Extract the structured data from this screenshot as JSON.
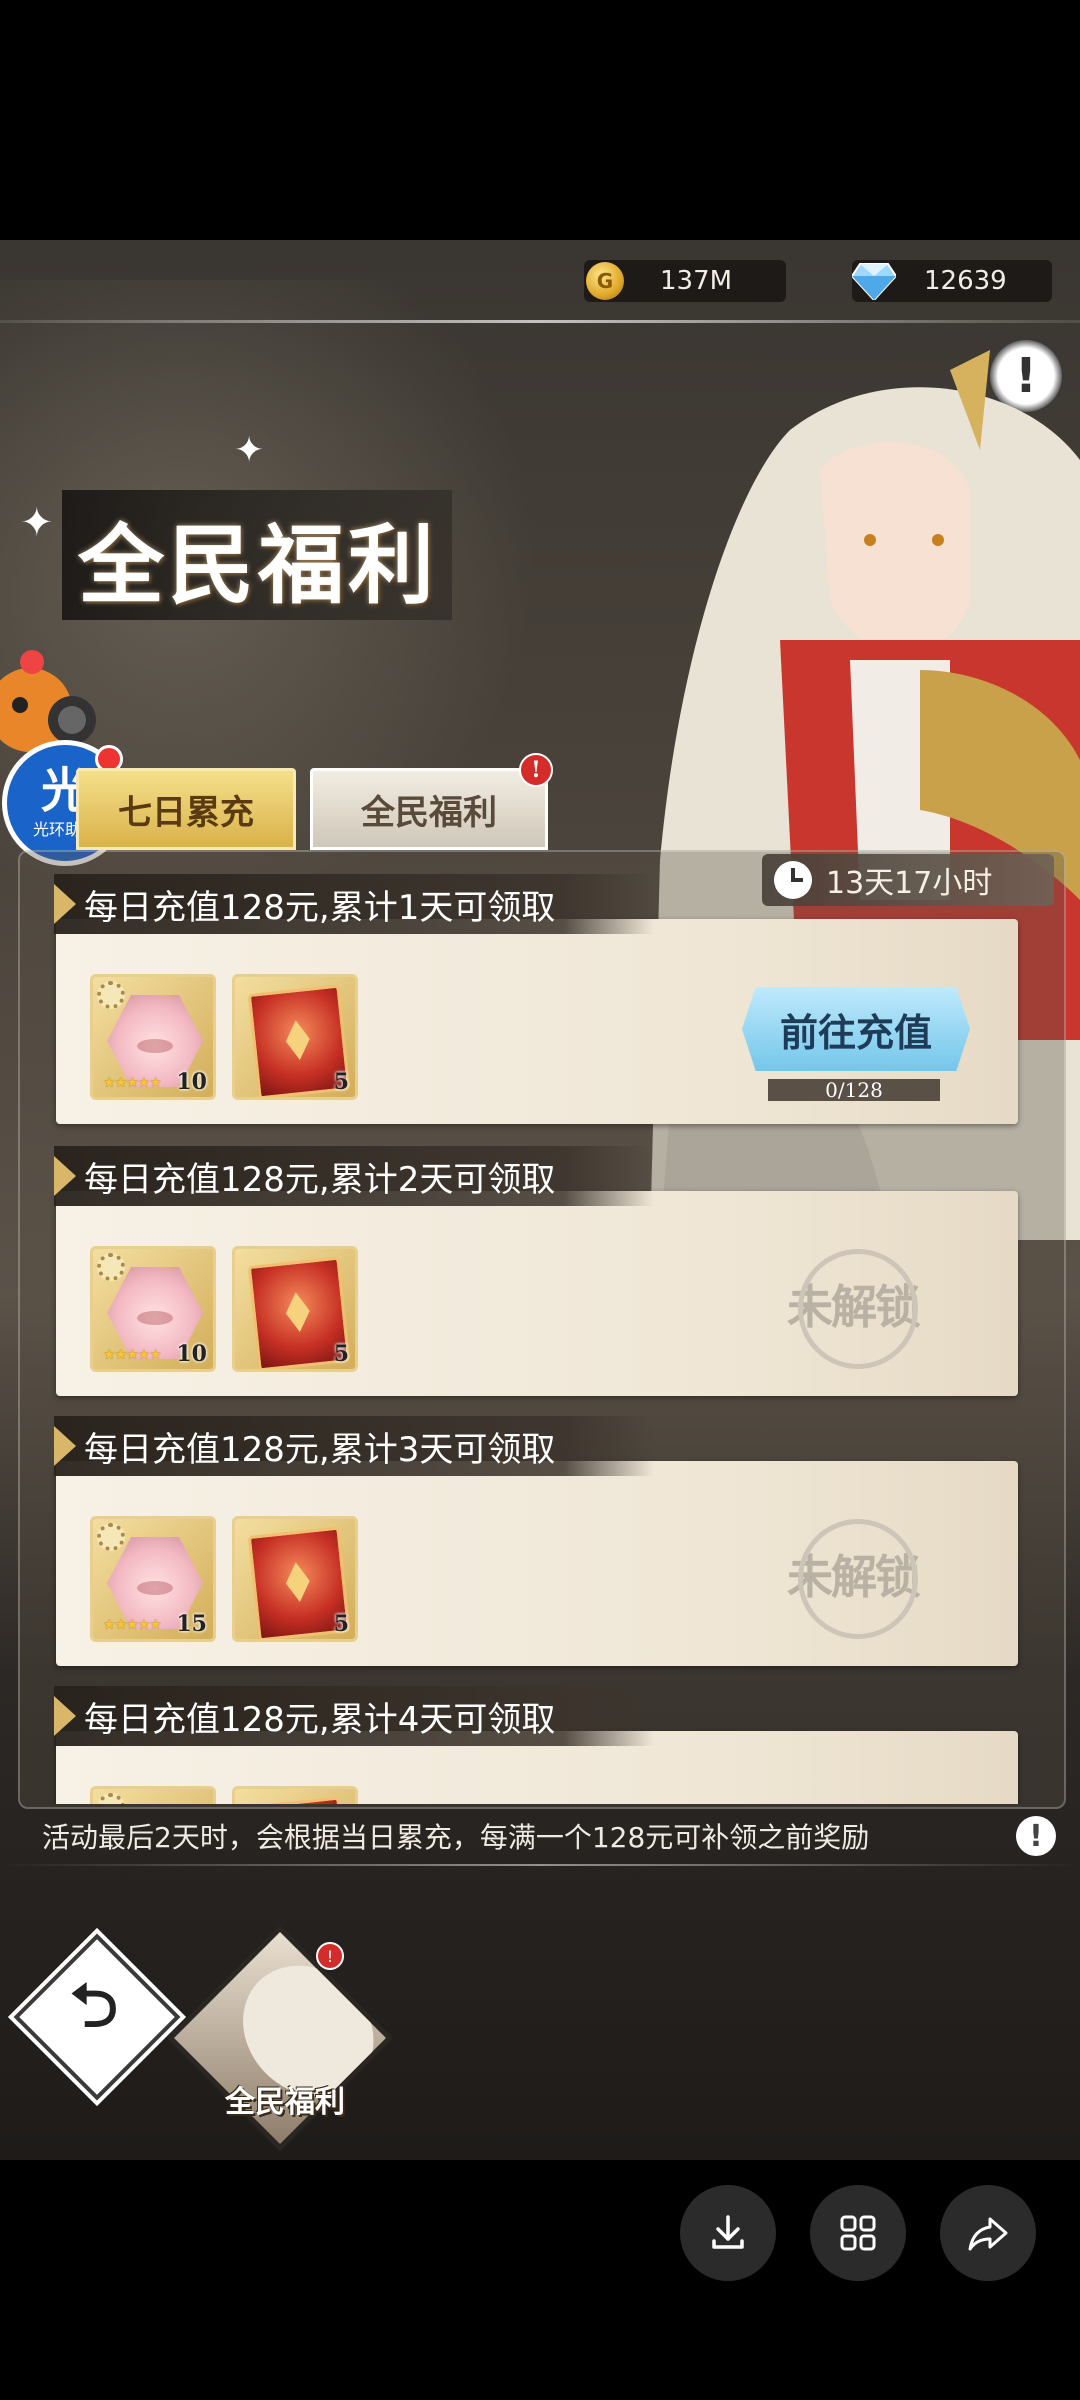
{
  "resources": {
    "gold": {
      "value": "137M",
      "icon": "gold-coin-icon"
    },
    "diamond": {
      "value": "12639",
      "icon": "diamond-icon"
    }
  },
  "header": {
    "title": "全民福利"
  },
  "assistant": {
    "badge": "光",
    "label": "光环助手"
  },
  "tabs": [
    {
      "label": "七日累充",
      "active": true
    },
    {
      "label": "全民福利",
      "active": false,
      "badge": "!"
    }
  ],
  "timer": {
    "text": "13天17小时"
  },
  "tasks": [
    {
      "title": "每日充值128元,累计1天可领取",
      "hero_qty": "10",
      "card_qty": "5",
      "action": "前往充值",
      "progress": "0/128",
      "locked": false
    },
    {
      "title": "每日充值128元,累计2天可领取",
      "hero_qty": "10",
      "card_qty": "5",
      "locked_label": "未解锁",
      "locked": true
    },
    {
      "title": "每日充值128元,累计3天可领取",
      "hero_qty": "15",
      "card_qty": "5",
      "locked_label": "未解锁",
      "locked": true
    },
    {
      "title": "每日充值128元,累计4天可领取",
      "locked": true
    }
  ],
  "stars": "★★★★★",
  "notice": {
    "text": "活动最后2天时，会根据当日累充，每满一个128元可补领之前奖励",
    "icon": "!"
  },
  "nav": {
    "back_symbol": "⮌",
    "current_label": "全民福利",
    "current_badge": "!"
  },
  "colors": {
    "gold": "#d9b24a",
    "go_button": "#74c6ea",
    "badge_red": "#d42b2b"
  }
}
